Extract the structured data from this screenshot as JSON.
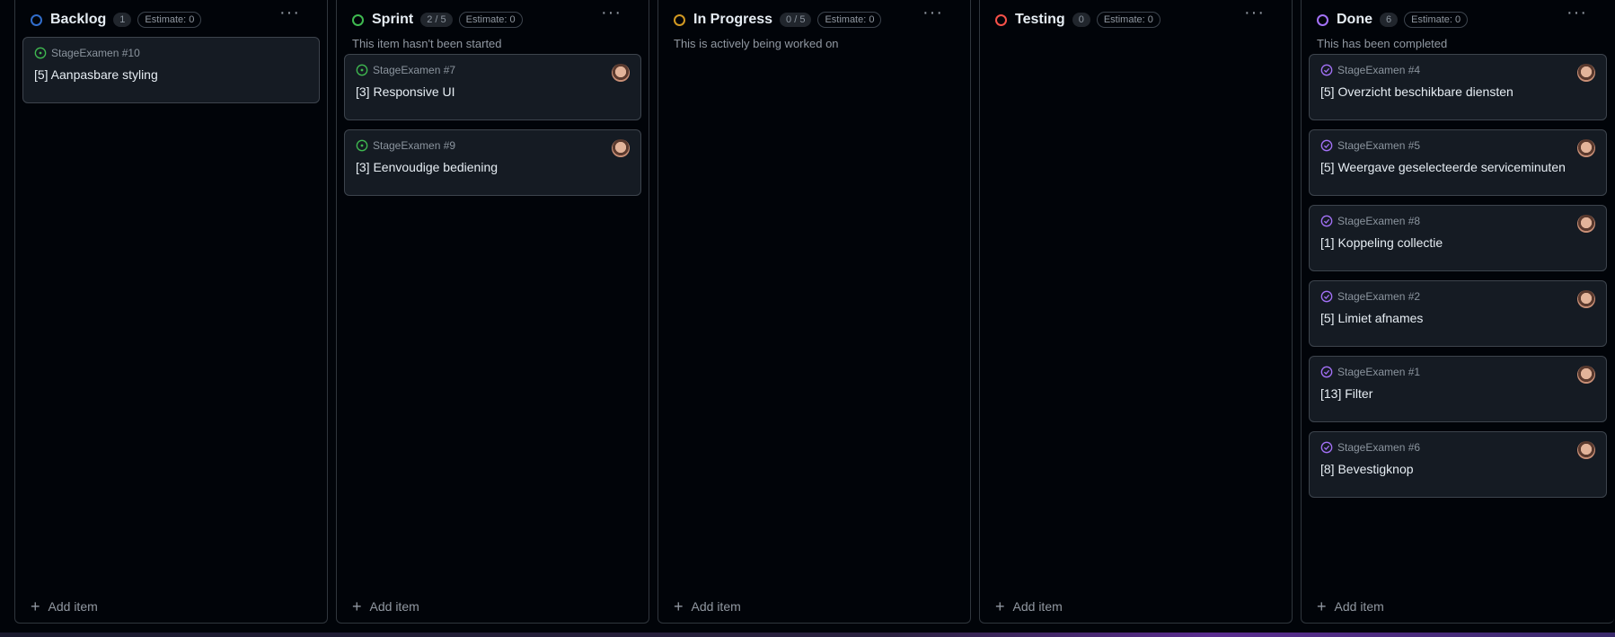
{
  "columns": [
    {
      "title": "Backlog",
      "count": "1",
      "estimate": "Estimate: 0",
      "description": "",
      "color": "#316dca",
      "add_label": "Add item",
      "cards": [
        {
          "ref": "StageExamen #10",
          "title": "[5] Aanpasbare styling",
          "state": "open",
          "avatar": false
        }
      ]
    },
    {
      "title": "Sprint",
      "count": "2 / 5",
      "estimate": "Estimate: 0",
      "description": "This item hasn't been started",
      "color": "#3fb950",
      "add_label": "Add item",
      "cards": [
        {
          "ref": "StageExamen #7",
          "title": "[3] Responsive UI",
          "state": "open",
          "avatar": true
        },
        {
          "ref": "StageExamen #9",
          "title": "[3] Eenvoudige bediening",
          "state": "open",
          "avatar": true
        }
      ]
    },
    {
      "title": "In Progress",
      "count": "0 / 5",
      "estimate": "Estimate: 0",
      "description": "This is actively being worked on",
      "color": "#d29922",
      "add_label": "Add item",
      "cards": []
    },
    {
      "title": "Testing",
      "count": "0",
      "estimate": "Estimate: 0",
      "description": "",
      "color": "#f85149",
      "add_label": "Add item",
      "cards": []
    },
    {
      "title": "Done",
      "count": "6",
      "estimate": "Estimate: 0",
      "description": "This has been completed",
      "color": "#a371f7",
      "add_label": "Add item",
      "cards": [
        {
          "ref": "StageExamen #4",
          "title": "[5] Overzicht beschikbare diensten",
          "state": "done",
          "avatar": true
        },
        {
          "ref": "StageExamen #5",
          "title": "[5] Weergave geselecteerde serviceminuten",
          "state": "done",
          "avatar": true
        },
        {
          "ref": "StageExamen #8",
          "title": "[1] Koppeling collectie",
          "state": "done",
          "avatar": true
        },
        {
          "ref": "StageExamen #2",
          "title": "[5] Limiet afnames",
          "state": "done",
          "avatar": true
        },
        {
          "ref": "StageExamen #1",
          "title": "[13] Filter",
          "state": "done",
          "avatar": true
        },
        {
          "ref": "StageExamen #6",
          "title": "[8] Bevestigknop",
          "state": "done",
          "avatar": true
        }
      ]
    }
  ],
  "icons": {
    "menu": "kebab-horizontal-icon",
    "add": "plus-icon",
    "open_issue": "issue-opened-icon",
    "done_issue": "issue-closed-icon"
  },
  "colors": {
    "open": "#3fb950",
    "done": "#a371f7"
  }
}
